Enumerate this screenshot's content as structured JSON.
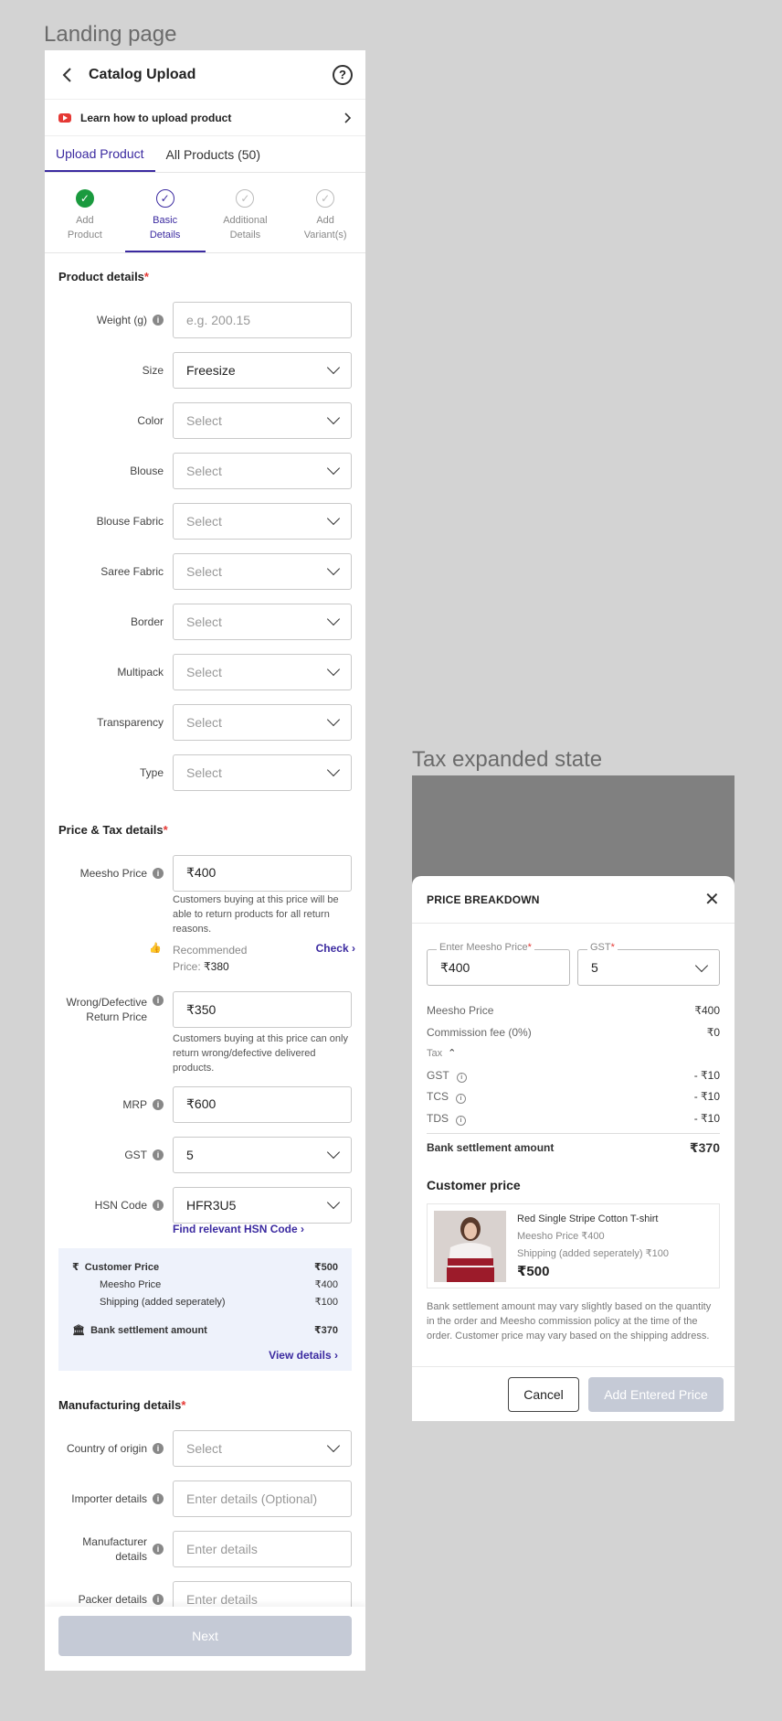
{
  "frame_labels": {
    "landing": "Landing page",
    "tax": "Tax expanded state"
  },
  "header": {
    "title": "Catalog Upload",
    "help": "?"
  },
  "learn": {
    "text": "Learn how to upload product"
  },
  "tabs": [
    {
      "label": "Upload Product"
    },
    {
      "label": "All Products (50)"
    }
  ],
  "steps": [
    {
      "l1": "Add",
      "l2": "Product",
      "state": "done"
    },
    {
      "l1": "Basic",
      "l2": "Details",
      "state": "current"
    },
    {
      "l1": "Additional",
      "l2": "Details",
      "state": "todo"
    },
    {
      "l1": "Add",
      "l2": "Variant(s)",
      "state": "todo"
    }
  ],
  "product_details": {
    "title": "Product details",
    "fields": [
      {
        "label": "Weight (g)",
        "value": "e.g. 200.15"
      },
      {
        "label": "Size",
        "value": "Freesize"
      },
      {
        "label": "Color",
        "value": "Select"
      },
      {
        "label": "Blouse",
        "value": "Select"
      },
      {
        "label": "Blouse Fabric",
        "value": "Select"
      },
      {
        "label": "Saree Fabric",
        "value": "Select"
      },
      {
        "label": "Border",
        "value": "Select"
      },
      {
        "label": "Multipack",
        "value": "Select"
      },
      {
        "label": "Transparency",
        "value": "Select"
      },
      {
        "label": "Type",
        "value": "Select"
      }
    ]
  },
  "price": {
    "title": "Price & Tax details",
    "meesho_label": "Meesho Price",
    "meesho_value": "₹400",
    "meesho_help": "Customers buying at this price will be able to return products for all return reasons.",
    "recommended": "Recommended",
    "rec_price_label": "Price:",
    "rec_price": "₹380",
    "check": "Check",
    "wrong_label1": "Wrong/Defective",
    "wrong_label2": "Return Price",
    "wrong_value": "₹350",
    "wrong_help": "Customers buying at this price can only return wrong/defective delivered products.",
    "mrp_label": "MRP",
    "mrp_value": "₹600",
    "gst_label": "GST",
    "gst_value": "5",
    "hsn_label": "HSN Code",
    "hsn_value": "HFR3U5",
    "find_hsn": "Find relevant HSN Code"
  },
  "summary": {
    "customer_price": "Customer Price",
    "customer_price_val": "₹500",
    "meesho_price": "Meesho Price",
    "meesho_price_val": "₹400",
    "shipping": "Shipping (added seperately)",
    "shipping_val": "₹100",
    "bank": "Bank settlement amount",
    "bank_val": "₹370",
    "view": "View details"
  },
  "manufacturing": {
    "title": "Manufacturing details",
    "fields": [
      {
        "label": "Country of origin",
        "value": "Select"
      },
      {
        "label": "Importer details",
        "value": "Enter details (Optional)"
      },
      {
        "label": "Manufacturer details",
        "value": "Enter details"
      },
      {
        "label": "Packer details",
        "value": "Enter details"
      }
    ]
  },
  "next": "Next",
  "modal": {
    "title": "PRICE BREAKDOWN",
    "price_caption": "Enter Meesho Price",
    "price_value": "₹400",
    "gst_caption": "GST",
    "gst_value": "5",
    "lines": [
      {
        "k": "Meesho Price",
        "v": "₹400"
      },
      {
        "k": "Commission fee (0%)",
        "v": "₹0"
      }
    ],
    "tax_label": "Tax",
    "tax_lines": [
      {
        "k": "GST",
        "v": "- ₹10"
      },
      {
        "k": "TCS",
        "v": "- ₹10"
      },
      {
        "k": "TDS",
        "v": "- ₹10"
      }
    ],
    "bank": "Bank settlement amount",
    "bank_val": "₹370",
    "customer_price": "Customer price",
    "product_name": "Red Single Stripe Cotton T-shirt",
    "product_meesho": "Meesho Price ₹400",
    "product_shipping": "Shipping (added seperately)  ₹100",
    "product_price": "₹500",
    "note": "Bank settlement amount may vary slightly based on the quantity in the order and Meesho commission policy at the time of the order. Customer price may vary based on the shipping address.",
    "cancel": "Cancel",
    "add": "Add Entered Price"
  }
}
